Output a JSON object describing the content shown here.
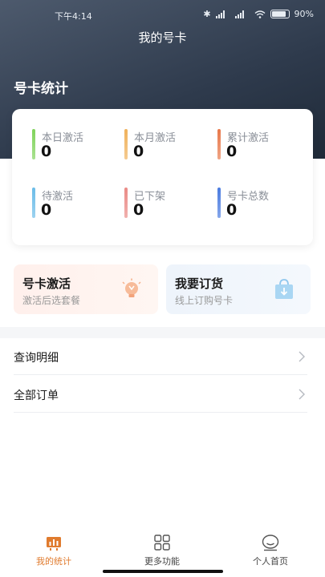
{
  "status_bar": {
    "time": "下午4:14",
    "battery": "90%"
  },
  "header": {
    "title": "我的号卡"
  },
  "stats_section": {
    "title": "号卡统计",
    "items": [
      {
        "label": "本日激活",
        "value": "0",
        "color": "#7fd35a"
      },
      {
        "label": "本月激活",
        "value": "0",
        "color": "#f0b15a"
      },
      {
        "label": "累计激活",
        "value": "0",
        "color": "#e8784a"
      },
      {
        "label": "待激活",
        "value": "0",
        "color": "#6bbce8"
      },
      {
        "label": "已下架",
        "value": "0",
        "color": "#ea8a86"
      },
      {
        "label": "号卡总数",
        "value": "0",
        "color": "#4a7be0"
      }
    ]
  },
  "promos": [
    {
      "title": "号卡激活",
      "subtitle": "激活后选套餐",
      "icon": "bulb-icon"
    },
    {
      "title": "我要订货",
      "subtitle": "线上订购号卡",
      "icon": "shopping-bag-icon"
    }
  ],
  "menu": [
    {
      "label": "查询明细"
    },
    {
      "label": "全部订单"
    }
  ],
  "tabs": [
    {
      "label": "我的统计",
      "icon": "stats-icon",
      "active": true
    },
    {
      "label": "更多功能",
      "icon": "grid-icon",
      "active": false
    },
    {
      "label": "个人首页",
      "icon": "profile-icon",
      "active": false
    }
  ],
  "colors": {
    "accent": "#e07b2e",
    "header_dark": "#2e3a4c"
  }
}
